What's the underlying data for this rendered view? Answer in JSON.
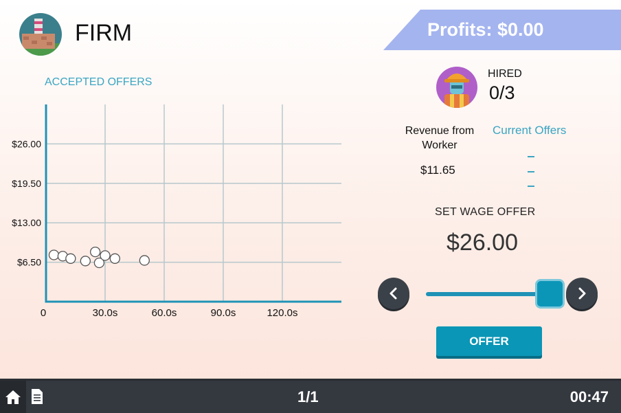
{
  "header": {
    "title": "FIRM",
    "profits": "Profits: $0.00",
    "profits_color": "#a4b4ef"
  },
  "chart_title": "ACCEPTED OFFERS",
  "chart_data": {
    "type": "scatter",
    "title": "ACCEPTED OFFERS",
    "xlabel": "",
    "ylabel": "",
    "xlim": [
      0,
      150
    ],
    "ylim": [
      0,
      32.5
    ],
    "x_ticks": [
      0,
      30,
      60,
      90,
      120
    ],
    "x_tick_labels": [
      "0",
      "30.0s",
      "60.0s",
      "90.0s",
      "120.0s"
    ],
    "y_ticks": [
      6.5,
      13,
      19.5,
      26
    ],
    "y_tick_labels": [
      "$6.50",
      "$13.00",
      "$19.50",
      "$26.00"
    ],
    "grid": true,
    "points": [
      {
        "x": 4,
        "y": 7.7
      },
      {
        "x": 8.5,
        "y": 7.5
      },
      {
        "x": 12.5,
        "y": 7.1
      },
      {
        "x": 20,
        "y": 6.7
      },
      {
        "x": 25,
        "y": 8.2
      },
      {
        "x": 27,
        "y": 6.4
      },
      {
        "x": 30,
        "y": 7.6
      },
      {
        "x": 35,
        "y": 7.1
      },
      {
        "x": 50,
        "y": 6.8
      }
    ],
    "axis_color": "#1f92b6",
    "grid_color": "#b7c8cc"
  },
  "worker": {
    "hired_label": "HIRED",
    "hired_value": "0/3",
    "revenue_label": "Revenue from Worker",
    "revenue_value": "$11.65",
    "current_offers_label": "Current Offers",
    "current_offers": [
      "–",
      "–",
      "–"
    ]
  },
  "wage": {
    "label": "SET WAGE OFFER",
    "value": "$26.00",
    "slider_fraction": 1.0
  },
  "offer_button": "OFFER",
  "footer": {
    "page": "1/1",
    "timer": "00:47"
  },
  "icons": {
    "firm": "factory-icon",
    "worker": "worker-icon",
    "prev": "chevron-left-icon",
    "next": "chevron-right-icon",
    "home": "home-icon",
    "doc": "document-icon"
  }
}
